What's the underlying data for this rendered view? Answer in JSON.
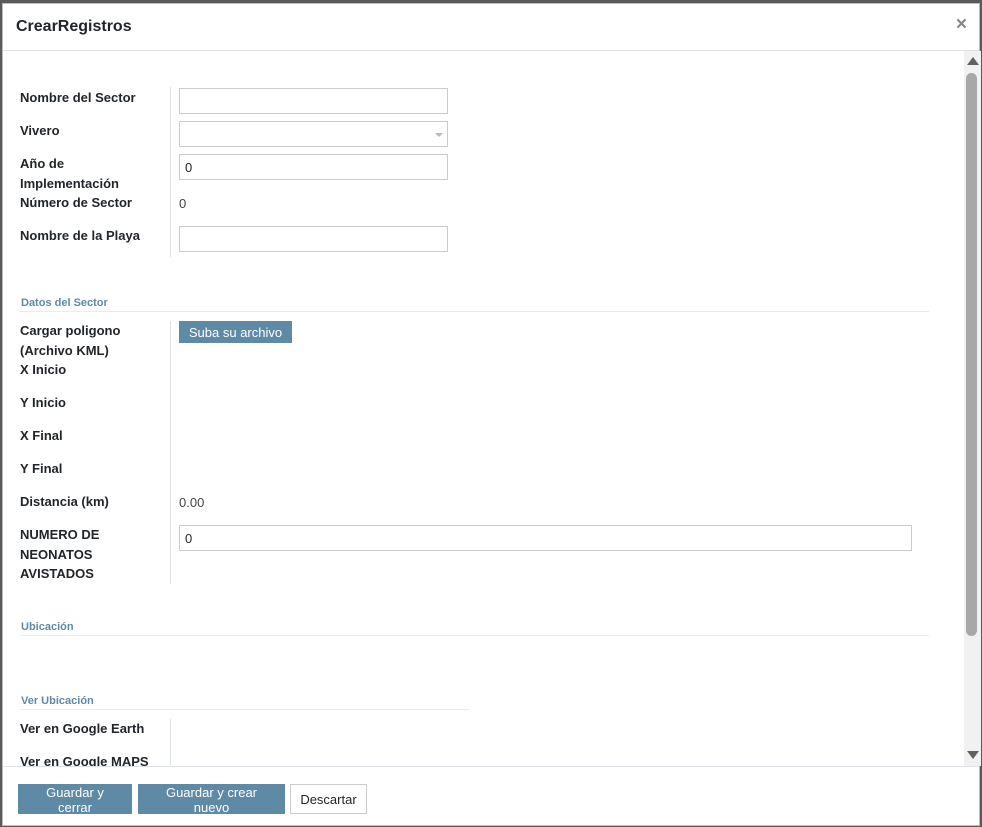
{
  "dialog": {
    "title": "CrearRegistros",
    "close_glyph": "×"
  },
  "form": {
    "nombre_sector_label": "Nombre del Sector",
    "nombre_sector_value": "",
    "vivero_label": "Vivero",
    "vivero_value": "",
    "anio_label": "Año de Implementación",
    "anio_value": "0",
    "numero_sector_label": "Número de Sector",
    "numero_sector_value": "0",
    "nombre_playa_label": "Nombre de la Playa",
    "nombre_playa_value": ""
  },
  "datos_sector": {
    "title": "Datos del Sector",
    "cargar_label": "Cargar poligono (Archivo KML)",
    "upload_button": "Suba su archivo",
    "x_inicio_label": "X Inicio",
    "y_inicio_label": "Y Inicio",
    "x_final_label": "X Final",
    "y_final_label": "Y Final",
    "distancia_label": "Distancia (km)",
    "distancia_value": "0.00",
    "neonatos_label": "NUMERO DE NEONATOS AVISTADOS",
    "neonatos_value": "0"
  },
  "ubicacion": {
    "title": "Ubicación"
  },
  "ver_ubicacion": {
    "title": "Ver Ubicación",
    "google_earth_label": "Ver en Google Earth",
    "google_maps_label": "Ver en Google MAPS"
  },
  "footer": {
    "save_close": "Guardar y cerrar",
    "save_new": "Guardar y crear nuevo",
    "discard": "Descartar"
  },
  "colors": {
    "accent": "#5f8aa6",
    "section_title": "#5f8aa6"
  }
}
